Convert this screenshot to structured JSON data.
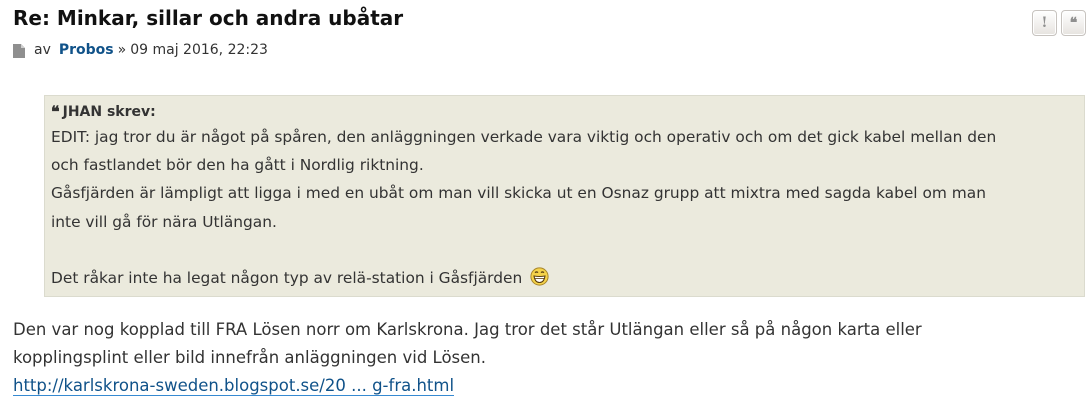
{
  "post": {
    "title": "Re: Minkar, sillar och andra ubåtar",
    "meta": {
      "by_label": "av",
      "author": "Probos",
      "separator": "»",
      "date": "09 maj 2016, 22:23",
      "icon": "document-icon"
    },
    "actions": [
      {
        "label": "!",
        "name": "report-button"
      },
      {
        "label": "❝",
        "name": "quote-button"
      }
    ],
    "quote": {
      "icon": "quote-icon",
      "cite": "JHAN skrev:",
      "lines": [
        "EDIT: jag tror du är något på spåren, den anläggningen verkade vara viktig och operativ och om det gick kabel mellan den",
        "och fastlandet bör den ha gått i Nordlig riktning.",
        "Gåsfjärden är lämpligt att ligga i med en ubåt om man vill skicka ut en Osnaz grupp att mixtra med sagda kabel om man",
        "inte vill gå för nära Utlängan."
      ],
      "last_line": "Det råkar inte ha legat någon typ av relä-station i Gåsfjärden",
      "smiley": "grinning-smiley-icon"
    },
    "reply": {
      "lines": [
        "Den var nog kopplad till FRA Lösen norr om Karlskrona. Jag tror det står Utlängan eller så på någon karta eller",
        "kopplingsplint eller bild innefrån anläggningen vid Lösen."
      ],
      "link_text": "http://karlskrona-sweden.blogspot.se/20 ... g-fra.html"
    }
  }
}
